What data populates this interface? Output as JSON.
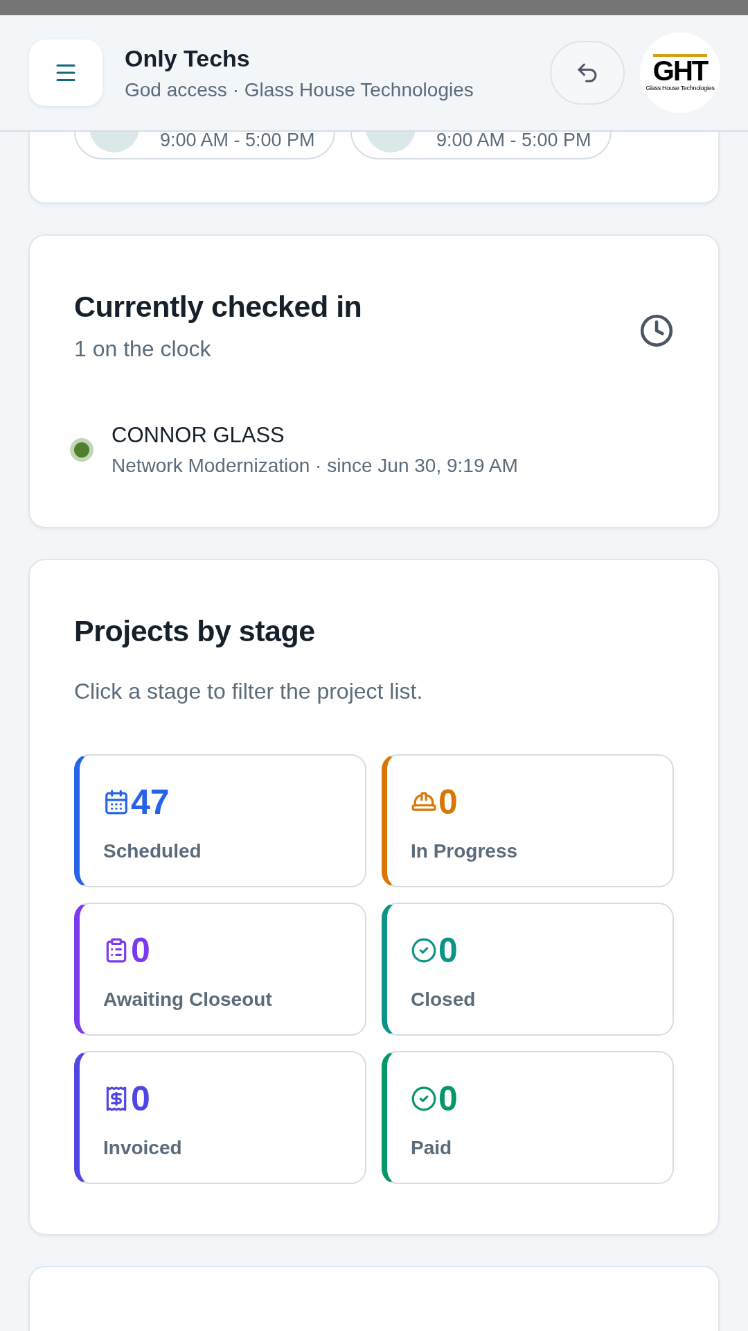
{
  "header": {
    "title": "Only Techs",
    "subtitle": "God access · Glass House Technologies",
    "logo": {
      "text": "GHT",
      "tagline": "Glass House Technologies"
    }
  },
  "hours_card": {
    "pills": [
      {
        "hours": "9:00 AM - 5:00 PM"
      },
      {
        "hours": "9:00 AM - 5:00 PM"
      }
    ]
  },
  "checked_in": {
    "title": "Currently checked in",
    "subtitle": "1 on the clock",
    "people": [
      {
        "name": "CONNOR GLASS",
        "detail": "Network Modernization · since Jun 30, 9:19 AM",
        "color": "#4f7f2f"
      }
    ]
  },
  "projects_by_stage": {
    "title": "Projects by stage",
    "subtitle": "Click a stage to filter the project list.",
    "stages": [
      {
        "kind": "calendar",
        "count": "47",
        "label": "Scheduled",
        "color": "#2563eb"
      },
      {
        "kind": "hardhat",
        "count": "0",
        "label": "In Progress",
        "color": "#d97706"
      },
      {
        "kind": "clipboard",
        "count": "0",
        "label": "Awaiting Closeout",
        "color": "#7c3aed"
      },
      {
        "kind": "check",
        "count": "0",
        "label": "Closed",
        "color": "#0d9488"
      },
      {
        "kind": "receipt",
        "count": "0",
        "label": "Invoiced",
        "color": "#4f46e5"
      },
      {
        "kind": "check",
        "count": "0",
        "label": "Paid",
        "color": "#059669"
      }
    ]
  }
}
